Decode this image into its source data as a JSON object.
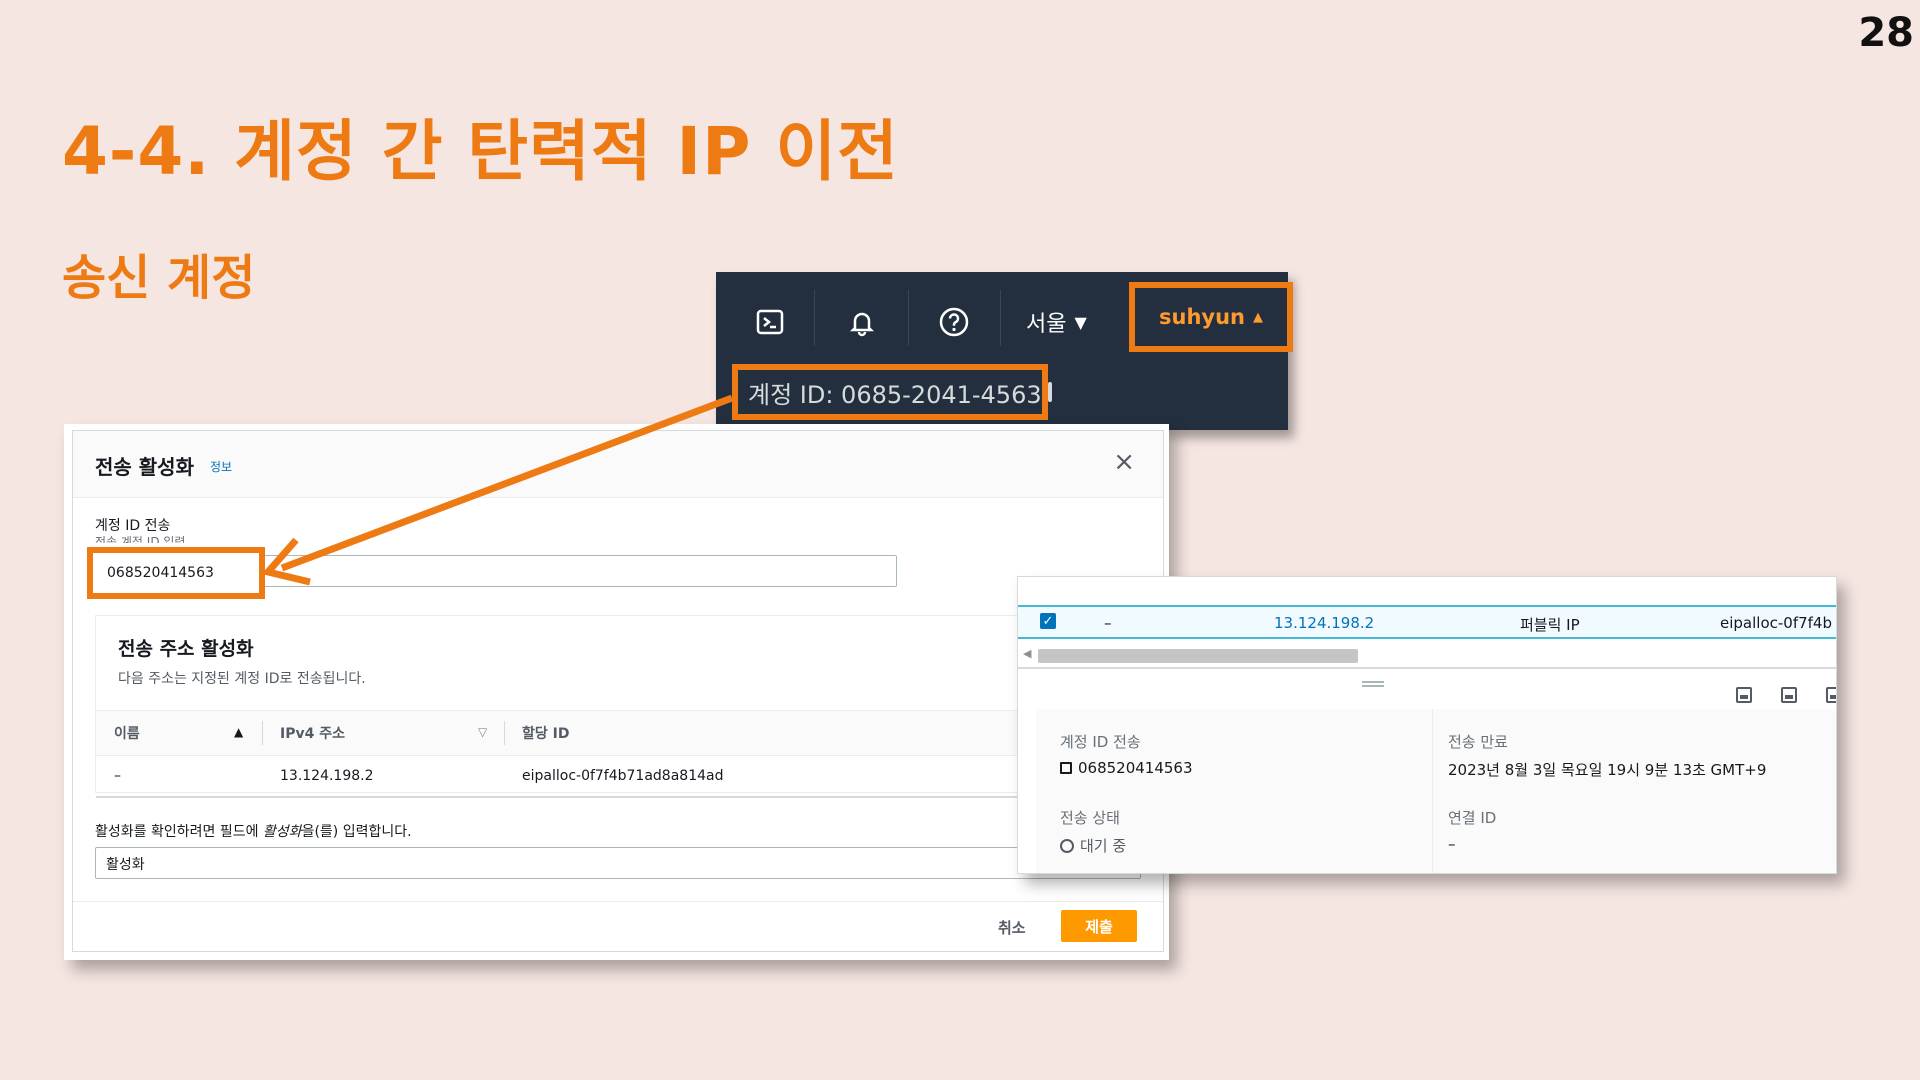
{
  "slide": {
    "page_number": "28",
    "title": "4-4. 계정 간 탄력적 IP 이전",
    "subtitle": "송신 계정"
  },
  "topbar": {
    "icons": [
      "cloudshell-icon",
      "bell-icon",
      "help-icon"
    ],
    "region_label": "서울",
    "region_caret": "▼",
    "user_label": "suhyun",
    "user_caret": "▲",
    "account_id_text": "계정 ID: 0685-2041-4563"
  },
  "modal": {
    "title": "전송 활성화",
    "info_link": "정보",
    "close": "×",
    "field_label": "계정 ID 전송",
    "field_description": "전송 계정 ID 입력",
    "field_value": "068520414563",
    "panel_title": "전송 주소 활성화",
    "panel_description": "다음 주소는 지정된 계정 ID로 전송됩니다.",
    "table": {
      "headers": [
        "이름",
        "IPv4 주소",
        "할당 ID"
      ],
      "rows": [
        [
          "–",
          "13.124.198.2",
          "eipalloc-0f7f4b71ad8a814ad"
        ]
      ]
    },
    "confirm_label_prefix": "활성화를 확인하려면 필드에 ",
    "confirm_label_keyword": "활성화",
    "confirm_label_suffix": "을(를) 입력합니다.",
    "confirm_value": "활성화",
    "cancel_label": "취소",
    "submit_label": "제출"
  },
  "detail": {
    "row": {
      "name": "–",
      "ip": "13.124.198.2",
      "type": "퍼블릭 IP",
      "alloc": "eipalloc-0f7f4b"
    },
    "fields": {
      "transfer_account_label": "계정 ID 전송",
      "transfer_account_value": "068520414563",
      "status_label": "전송 상태",
      "status_value": "대기 중",
      "expiry_label": "전송 만료",
      "expiry_value": "2023년 8월 3일 목요일 19시 9분 13초 GMT+9",
      "association_label": "연결 ID",
      "association_value": "–"
    }
  },
  "colors": {
    "accent": "#ee7a14",
    "aws_nav": "#232f3e",
    "submit": "#ff9900",
    "link": "#0073bb"
  }
}
